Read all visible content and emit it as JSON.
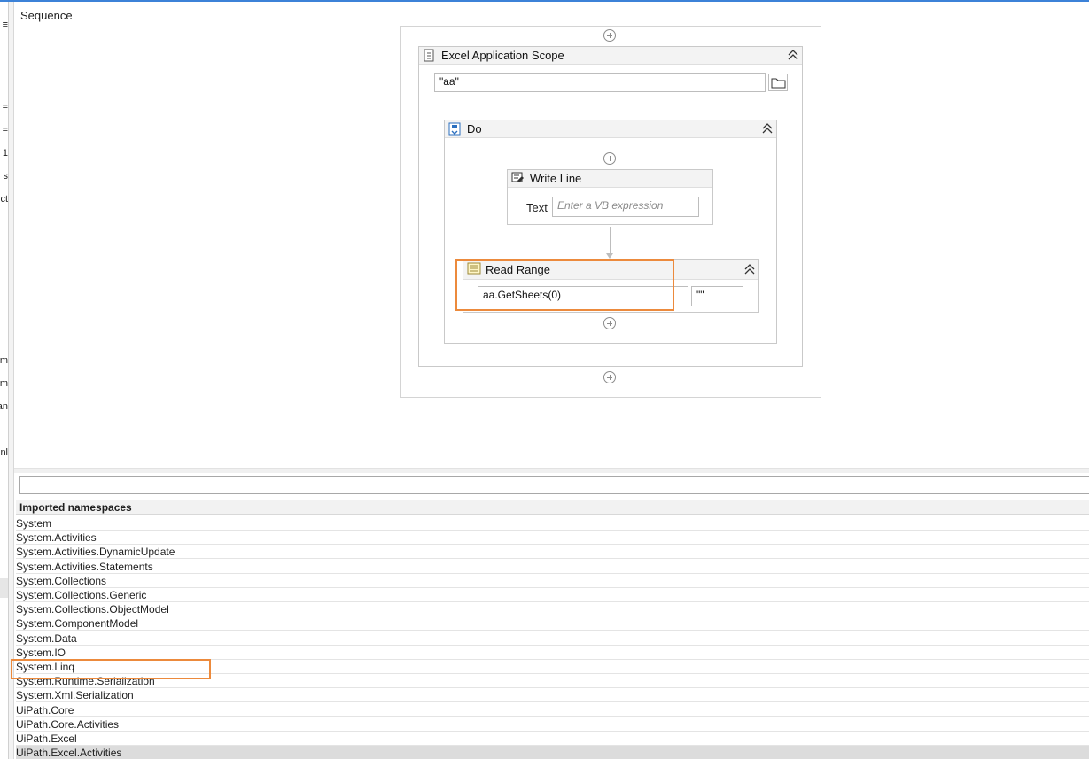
{
  "header": {
    "title": "Sequence"
  },
  "left_panel": {
    "fragments": [
      "=",
      "=",
      "1",
      "s",
      "ct",
      "m",
      "m",
      "an",
      "nl"
    ]
  },
  "designer": {
    "excel_scope": {
      "title": "Excel Application Scope",
      "path_value": "\"aa\"",
      "browse_icon": "folder-icon"
    },
    "do_block": {
      "title": "Do"
    },
    "write_line": {
      "title": "Write Line",
      "text_label": "Text",
      "text_placeholder": "Enter a VB expression"
    },
    "read_range": {
      "title": "Read Range",
      "sheet_value": "aa.GetSheets(0)",
      "range_value": "\"\""
    }
  },
  "namespaces": {
    "search_value": "",
    "header": "Imported namespaces",
    "items": [
      "System",
      "System.Activities",
      "System.Activities.DynamicUpdate",
      "System.Activities.Statements",
      "System.Collections",
      "System.Collections.Generic",
      "System.Collections.ObjectModel",
      "System.ComponentModel",
      "System.Data",
      "System.IO",
      "System.Linq",
      "System.Runtime.Serialization",
      "System.Xml.Serialization",
      "UiPath.Core",
      "UiPath.Core.Activities",
      "UiPath.Excel",
      "UiPath.Excel.Activities"
    ],
    "selected_index": 16,
    "highlighted_item": "System.Linq"
  },
  "colors": {
    "highlight_border": "#ec8a3c",
    "accent": "#3c82d8"
  }
}
